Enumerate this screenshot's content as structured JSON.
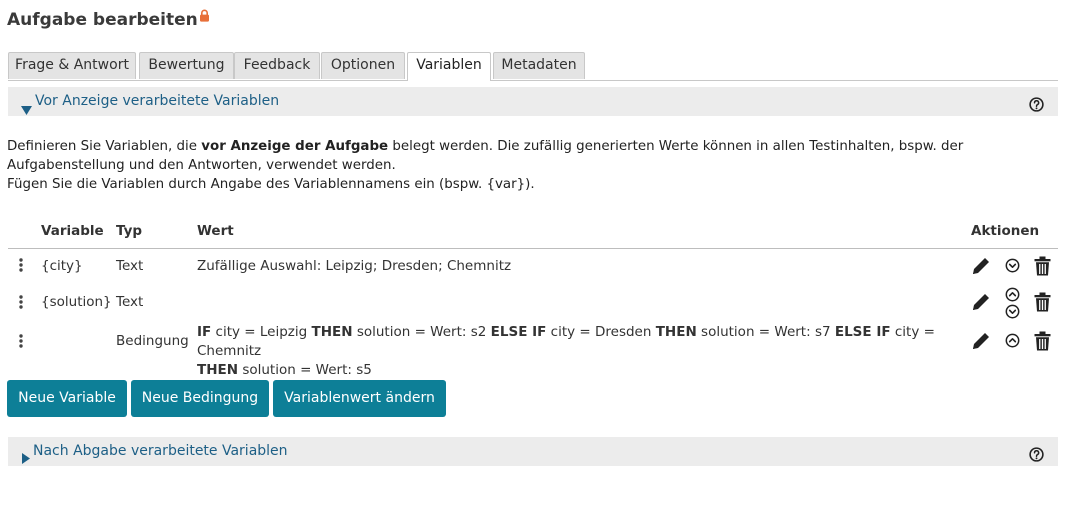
{
  "page": {
    "title": "Aufgabe bearbeiten",
    "lock_icon": "lock-icon"
  },
  "tabs": [
    {
      "label": "Frage & Antwort"
    },
    {
      "label": "Bewertung"
    },
    {
      "label": "Feedback"
    },
    {
      "label": "Optionen"
    },
    {
      "label": "Variablen",
      "active": true
    },
    {
      "label": "Metadaten"
    }
  ],
  "section_before": {
    "label": "Vor Anzeige verarbeitete Variablen",
    "expanded": true
  },
  "description": {
    "line1_pre": "Definieren Sie Variablen, die ",
    "line1_bold": "vor Anzeige der Aufgabe",
    "line1_post": " belegt werden. Die zufällig generierten Werte können in allen Testinhalten, bspw. der Aufgabenstellung und den Antworten, verwendet werden.",
    "line2": "Fügen Sie die Variablen durch Angabe des Variablennamens ein (bspw. {var})."
  },
  "table": {
    "headers": {
      "variable": "Variable",
      "typ": "Typ",
      "wert": "Wert",
      "aktionen": "Aktionen"
    },
    "rows": [
      {
        "variable": "{city}",
        "typ": "Text",
        "wert": "Zufällige Auswahl: Leipzig; Dresden; Chemnitz"
      },
      {
        "variable": "{solution}",
        "typ": "Text",
        "wert": ""
      },
      {
        "variable": "",
        "typ": "Bedingung",
        "wert_parts": [
          "IF",
          " city = Leipzig ",
          "THEN",
          " solution = Wert: s2 ",
          "ELSE IF",
          " city = Dresden ",
          "THEN",
          " solution = Wert: s7 ",
          "ELSE IF",
          " city = Chemnitz ",
          "THEN",
          " solution = Wert: s5"
        ]
      }
    ]
  },
  "buttons": {
    "new_variable": "Neue Variable",
    "new_condition": "Neue Bedingung",
    "change_value": "Variablenwert ändern"
  },
  "section_after": {
    "label": "Nach Abgabe verarbeitete Variablen",
    "expanded": false
  },
  "colors": {
    "accent": "#0d7f97",
    "link": "#1d5f86",
    "section_bg": "#ececec",
    "lock": "#e8703a"
  }
}
